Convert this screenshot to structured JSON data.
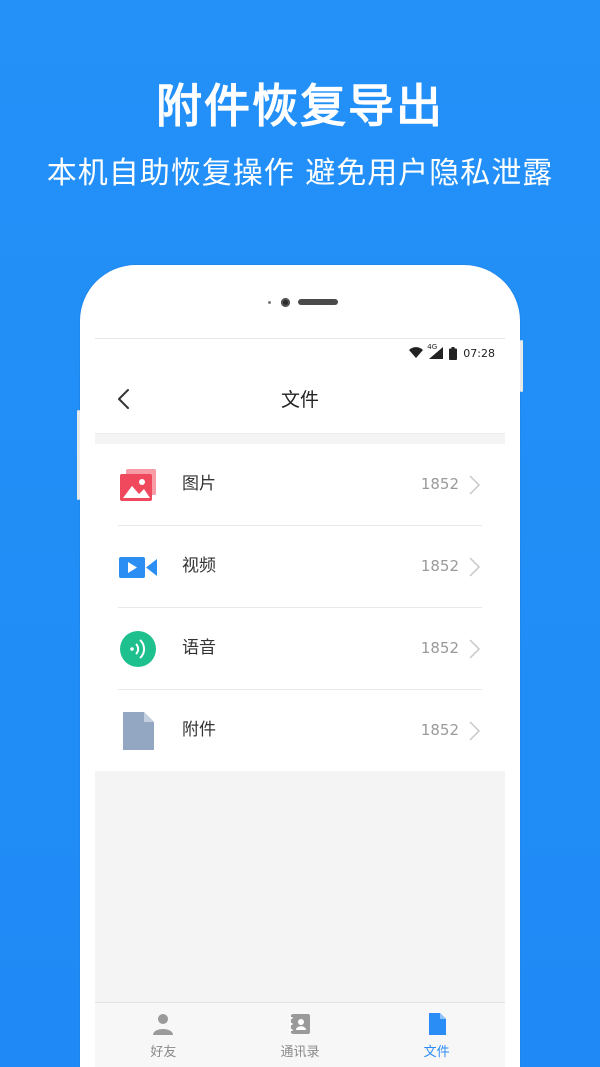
{
  "promo": {
    "headline": "附件恢复导出",
    "subline": "本机自助恢复操作 避免用户隐私泄露"
  },
  "statusbar": {
    "network": "4G",
    "time": "07:28"
  },
  "appbar": {
    "title": "文件"
  },
  "list": {
    "items": [
      {
        "label": "图片",
        "count": "1852",
        "icon": "image-icon",
        "color": "#f0485c"
      },
      {
        "label": "视频",
        "count": "1852",
        "icon": "video-icon",
        "color": "#2b8ef2"
      },
      {
        "label": "语音",
        "count": "1852",
        "icon": "voice-icon",
        "color": "#1ec08d"
      },
      {
        "label": "附件",
        "count": "1852",
        "icon": "file-icon",
        "color": "#93a7c2"
      }
    ]
  },
  "tabbar": {
    "tabs": [
      {
        "label": "好友",
        "icon": "person-icon",
        "active": false
      },
      {
        "label": "通讯录",
        "icon": "contacts-book-icon",
        "active": false
      },
      {
        "label": "文件",
        "icon": "document-icon",
        "active": true
      }
    ]
  },
  "colors": {
    "background": "#1f8cf7",
    "accent": "#2a8cf5"
  }
}
